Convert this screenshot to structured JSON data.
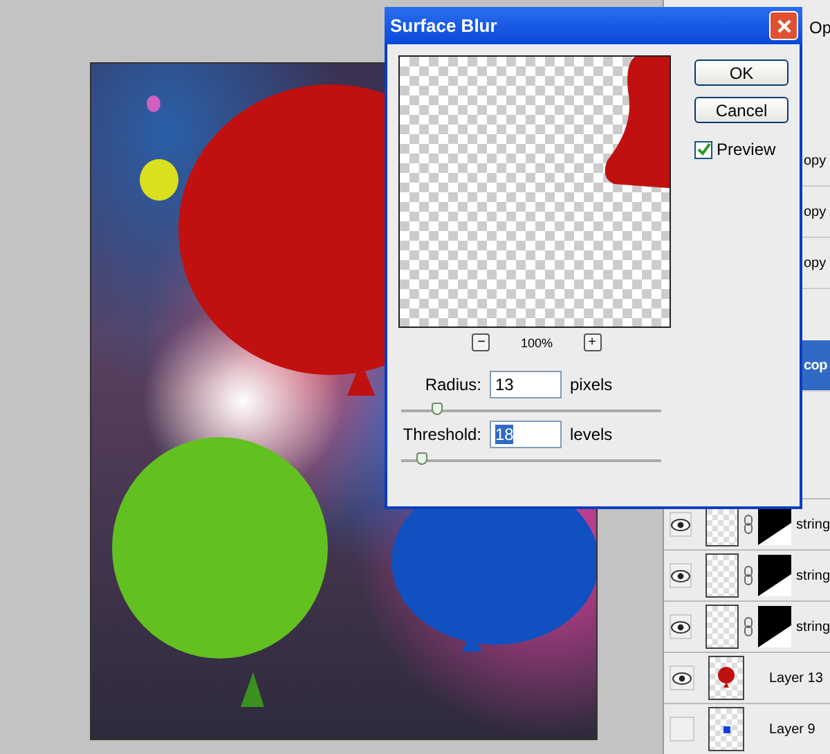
{
  "dialog": {
    "title": "Surface Blur",
    "zoom": "100%",
    "zoom_out": "−",
    "zoom_in": "+",
    "fields": [
      {
        "label": "Radius:",
        "value": "13",
        "unit": "pixels",
        "text_selected": false,
        "level": 0.14
      },
      {
        "label": "Threshold:",
        "value": "18",
        "unit": "levels",
        "text_selected": true,
        "level": 0.08
      }
    ],
    "buttons": [
      "OK",
      "Cancel"
    ],
    "preview": {
      "label": "Preview",
      "checked": true
    }
  },
  "layers_panel": {
    "opacity_label": "Op",
    "upper_rows": [
      {
        "name": "opy",
        "selected": false
      },
      {
        "name": "opy",
        "selected": false
      },
      {
        "name": "opy",
        "selected": false
      },
      {
        "name": "cop",
        "selected": true
      }
    ],
    "rows": [
      {
        "name": "string",
        "visible": true,
        "mask": true,
        "kind": "empty"
      },
      {
        "name": "string",
        "visible": true,
        "mask": true,
        "kind": "empty"
      },
      {
        "name": "string",
        "visible": true,
        "mask": true,
        "kind": "empty"
      },
      {
        "name": "Layer 13",
        "visible": true,
        "mask": false,
        "kind": "balloon"
      },
      {
        "name": "Layer 9",
        "visible": false,
        "mask": false,
        "kind": "dot"
      }
    ]
  }
}
